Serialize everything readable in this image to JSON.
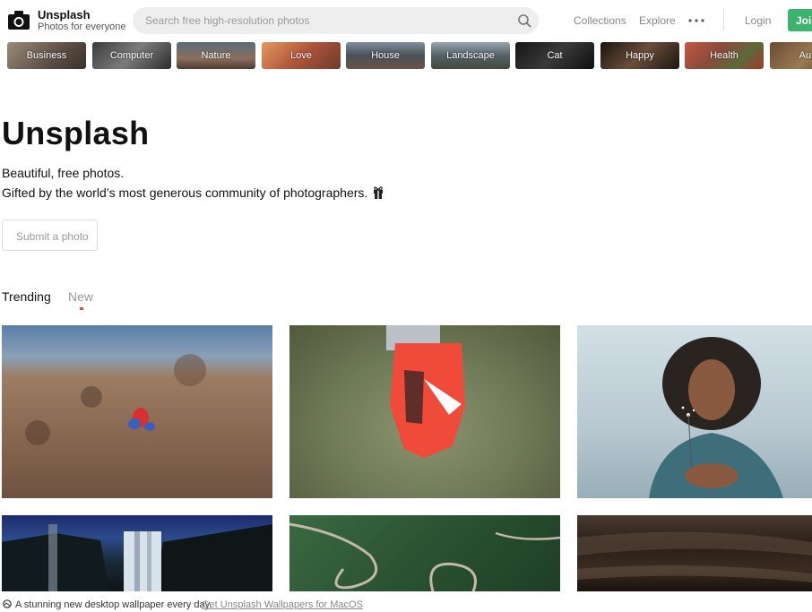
{
  "header": {
    "brand_name": "Unsplash",
    "brand_tagline": "Photos for everyone",
    "search_placeholder": "Search free high-resolution photos",
    "nav_collections": "Collections",
    "nav_explore": "Explore",
    "nav_login": "Login",
    "nav_join": "Join",
    "accent_color": "#3cb46e"
  },
  "categories": [
    "Business",
    "Computer",
    "Nature",
    "Love",
    "House",
    "Landscape",
    "Cat",
    "Happy",
    "Health",
    "Autu"
  ],
  "hero": {
    "title": "Unsplash",
    "line1": "Beautiful, free photos.",
    "line2": "Gifted by the world’s most generous community of photographers.",
    "submit_label": "Submit a photo"
  },
  "tabs": {
    "trending": "Trending",
    "new": "New"
  },
  "footer": {
    "text": "A stunning new desktop wallpaper every day.",
    "link": "Get Unsplash Wallpapers for MacOS"
  }
}
